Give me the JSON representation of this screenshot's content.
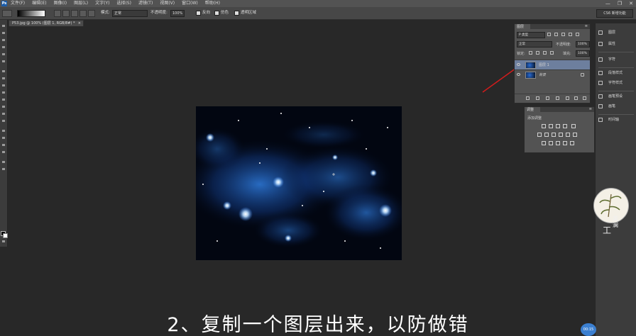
{
  "menu": {
    "logo": "Ps",
    "items": [
      "文件(F)",
      "编辑(E)",
      "图像(I)",
      "图层(L)",
      "文字(Y)",
      "选择(S)",
      "滤镜(T)",
      "视图(V)",
      "窗口(W)",
      "帮助(H)"
    ],
    "window_controls": [
      "—",
      "❐",
      "✕"
    ]
  },
  "options": {
    "mode_label": "模式:",
    "mode_value": "正常",
    "opacity_label": "不透明度:",
    "opacity_value": "100%",
    "reverse_label": "反向",
    "dither_label": "仿色",
    "transparency_label": "透明区域",
    "workspace": "CS6 新增功能"
  },
  "document": {
    "tab_title": "P53.jpg @ 100% (图层 1, RGB/8#) *",
    "close": "×"
  },
  "layers_panel": {
    "tab": "图层",
    "kind_filter": "P 类型",
    "blend_mode": "正常",
    "opacity_label": "不透明度:",
    "opacity_value": "100%",
    "lock_label": "锁定:",
    "fill_label": "填充:",
    "fill_value": "100%",
    "layers": [
      {
        "name": "图层 1"
      },
      {
        "name": "背景"
      }
    ]
  },
  "adjustments_panel": {
    "tab": "调整",
    "title": "添加调整"
  },
  "right_dock": {
    "items": [
      "图层",
      "属性",
      "字符",
      "段落样式",
      "字符样式",
      "画笔预设",
      "画笔",
      "时间轴"
    ]
  },
  "logo": {
    "text_a": "工",
    "text_b": "英澜"
  },
  "subtitle": "2、复制一个图层出来，以防做错",
  "badge": "00:15",
  "colors": {
    "accent": "#3b7fd0",
    "arrow": "#d21c1c"
  }
}
